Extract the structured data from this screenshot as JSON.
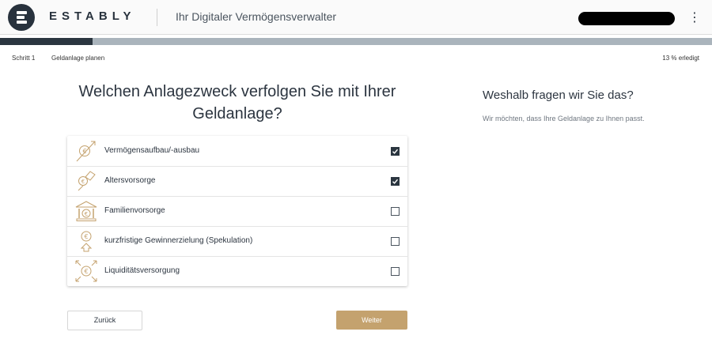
{
  "header": {
    "brand": "ESTABLY",
    "tagline": "Ihr Digitaler Vermögensverwalter",
    "menu_icon": "more-vert-icon"
  },
  "progress": {
    "step_label": "Schritt 1",
    "step_name": "Geldanlage planen",
    "percent_text": "13 % erledigt",
    "fraction": 0.13
  },
  "question": "Welchen Anlagezweck verfolgen Sie mit Ihrer Geldanlage?",
  "options": [
    {
      "label": "Vermögensaufbau/-ausbau",
      "checked": true,
      "icon": "growth-coin-icon"
    },
    {
      "label": "Altersvorsorge",
      "checked": true,
      "icon": "hand-coin-icon"
    },
    {
      "label": "Familienvorsorge",
      "checked": false,
      "icon": "bank-building-icon"
    },
    {
      "label": "kurzfristige Gewinnerzielung (Spekulation)",
      "checked": false,
      "icon": "coin-arrow-up-icon"
    },
    {
      "label": "Liquiditätsversorgung",
      "checked": false,
      "icon": "coin-arrows-out-icon"
    }
  ],
  "sidebar": {
    "title": "Weshalb fragen wir Sie das?",
    "text": "Wir möchten, dass Ihre Geldanlage zu Ihnen passt."
  },
  "buttons": {
    "back": "Zurück",
    "next": "Weiter"
  },
  "colors": {
    "accent": "#c4a26e",
    "dark": "#2b3640",
    "progress_track": "#aab4bc"
  }
}
